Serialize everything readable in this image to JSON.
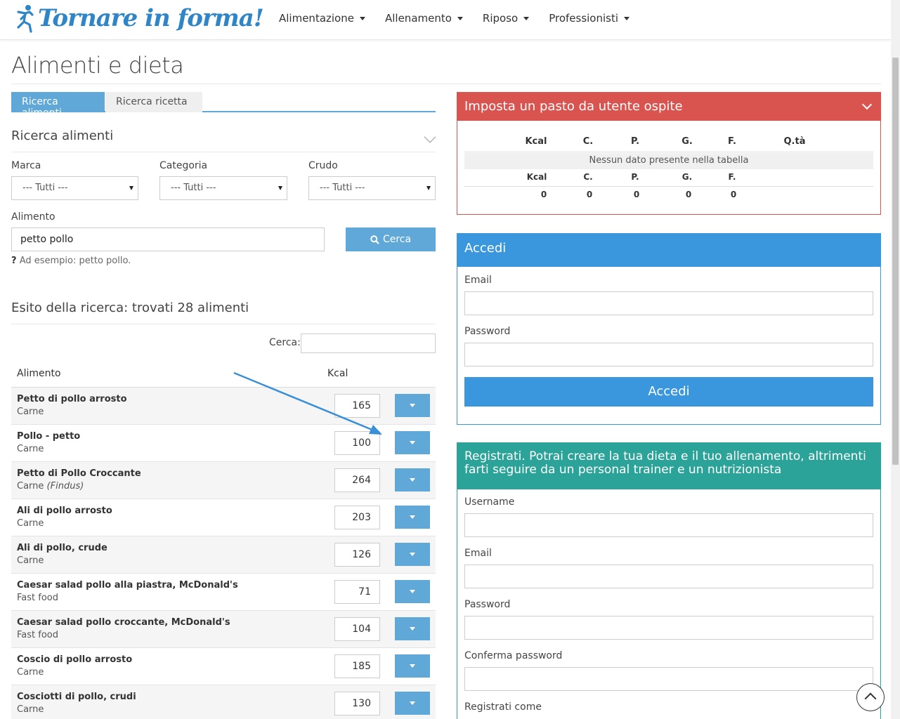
{
  "header": {
    "logo_text": "Tornare in forma!",
    "nav": [
      {
        "label": "Alimentazione"
      },
      {
        "label": "Allenamento"
      },
      {
        "label": "Riposo"
      },
      {
        "label": "Professionisti"
      }
    ]
  },
  "page": {
    "title": "Alimenti e dieta"
  },
  "tabs": [
    {
      "label": "Ricerca alimenti",
      "active": true
    },
    {
      "label": "Ricerca ricetta",
      "active": false
    }
  ],
  "search": {
    "section_title": "Ricerca alimenti",
    "marca_label": "Marca",
    "marca_value": "--- Tutti ---",
    "categoria_label": "Categoria",
    "categoria_value": "--- Tutti ---",
    "crudo_label": "Crudo",
    "crudo_value": "--- Tutti ---",
    "alimento_label": "Alimento",
    "alimento_value": "petto pollo",
    "button_label": "Cerca",
    "hint_mark": "?",
    "hint_text": "Ad esempio: petto pollo."
  },
  "results": {
    "title": "Esito della ricerca: trovati 28 alimenti",
    "filter_label": "Cerca:",
    "filter_value": "",
    "col_alimento": "Alimento",
    "col_kcal": "Kcal",
    "rows": [
      {
        "name": "Petto di pollo arrosto",
        "category": "Carne",
        "brand": "",
        "kcal": "165"
      },
      {
        "name": "Pollo - petto",
        "category": "Carne",
        "brand": "",
        "kcal": "100"
      },
      {
        "name": "Petto di Pollo Croccante",
        "category": "Carne",
        "brand": "(Findus)",
        "kcal": "264"
      },
      {
        "name": "Ali di pollo arrosto",
        "category": "Carne",
        "brand": "",
        "kcal": "203"
      },
      {
        "name": "Ali di pollo, crude",
        "category": "Carne",
        "brand": "",
        "kcal": "126"
      },
      {
        "name": "Caesar salad pollo alla piastra, McDonald's",
        "category": "Fast food",
        "brand": "",
        "kcal": "71"
      },
      {
        "name": "Caesar salad pollo croccante, McDonald's",
        "category": "Fast food",
        "brand": "",
        "kcal": "104"
      },
      {
        "name": "Coscio di pollo arrosto",
        "category": "Carne",
        "brand": "",
        "kcal": "185"
      },
      {
        "name": "Cosciotti di pollo, crudi",
        "category": "Carne",
        "brand": "",
        "kcal": "130"
      }
    ]
  },
  "meal_panel": {
    "title": "Imposta un pasto da utente ospite",
    "headers": [
      "Kcal",
      "C.",
      "P.",
      "G.",
      "F.",
      "Q.tà"
    ],
    "empty_text": "Nessun dato presente nella tabella",
    "footer_headers": [
      "Kcal",
      "C.",
      "P.",
      "G.",
      "F."
    ],
    "totals": [
      "0",
      "0",
      "0",
      "0",
      "0"
    ]
  },
  "login_panel": {
    "title": "Accedi",
    "email_label": "Email",
    "password_label": "Password",
    "button_label": "Accedi"
  },
  "register_panel": {
    "title": "Registrati. Potrai creare la tua dieta e il tuo allenamento, altrimenti farti seguire da un personal trainer e un nutrizionista",
    "username_label": "Username",
    "email_label": "Email",
    "password_label": "Password",
    "confirm_label": "Conferma password",
    "register_as_label": "Registrati come"
  },
  "colors": {
    "brand_blue": "#2e85c8",
    "button_blue": "#5fa8d8",
    "panel_red": "#d9534f",
    "panel_blue": "#3a96dd",
    "panel_green": "#2ba398"
  }
}
